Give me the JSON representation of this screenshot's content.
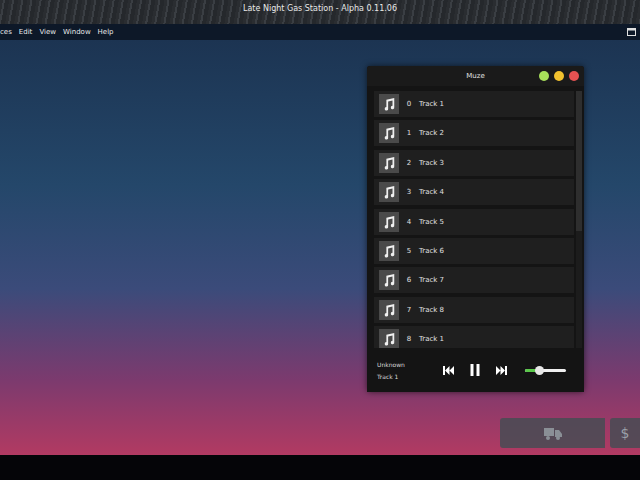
{
  "window": {
    "title": "Late Night Gas Station - Alpha 0.11.06"
  },
  "menu": [
    "ces",
    "Edit",
    "View",
    "Window",
    "Help"
  ],
  "player": {
    "title": "Muze",
    "tracks": [
      {
        "index": "0",
        "name": "Track 1",
        "selected": false
      },
      {
        "index": "1",
        "name": "Track 2",
        "selected": false
      },
      {
        "index": "2",
        "name": "Track 3",
        "selected": false
      },
      {
        "index": "3",
        "name": "Track 4",
        "selected": false
      },
      {
        "index": "4",
        "name": "Track 5",
        "selected": false
      },
      {
        "index": "5",
        "name": "Track 6",
        "selected": false
      },
      {
        "index": "6",
        "name": "Track 7",
        "selected": false
      },
      {
        "index": "7",
        "name": "Track 8",
        "selected": false
      },
      {
        "index": "8",
        "name": "Track 1",
        "selected": false
      }
    ],
    "now_playing": {
      "artist": "Unknown",
      "track": "Track 1"
    },
    "playing": true,
    "volume": {
      "level": 0.35
    }
  },
  "hud_buttons": [
    {
      "kind": "truck",
      "label": ""
    },
    {
      "kind": "text",
      "label": "$"
    }
  ]
}
